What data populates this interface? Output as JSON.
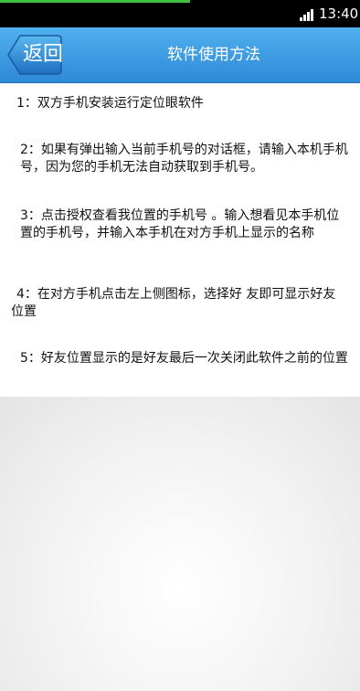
{
  "status_bar": {
    "time": "13:40",
    "signal_icon": "signal-bars-icon"
  },
  "header": {
    "back_label": "返回",
    "title": "软件使用方法"
  },
  "steps": [
    "1：双方手机安装运行定位眼软件",
    "2：如果有弹出输入当前手机号的对话框，请输入本机手机号，因为您的手机无法自动获取到手机号。",
    "3：点击授权查看我位置的手机号 。输入想看见本手机位置的手机号，并输入本手机在对方手机上显示的名称",
    "4：在对方手机点击左上侧图标，选择好 友即可显示好友位置",
    "5：好友位置显示的是好友最后一次关闭此软件之前的位置"
  ],
  "colors": {
    "title_bar": "#2f8ad8",
    "status_bar": "#000000",
    "content_background": "#ffffff"
  }
}
